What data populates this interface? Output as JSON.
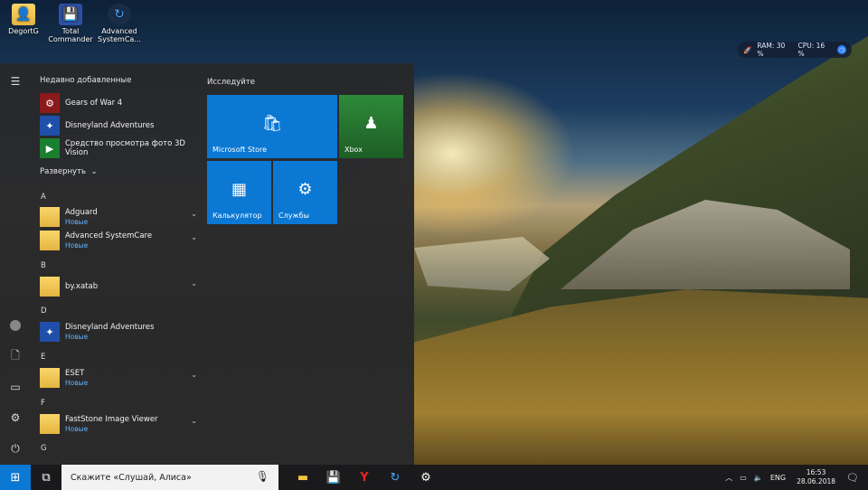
{
  "desktop": {
    "icons": [
      {
        "label": "DegortG",
        "icon": "folder-user-icon"
      },
      {
        "label": "Total Commander",
        "icon": "floppy-disk-icon"
      },
      {
        "label": "Advanced SystemCa...",
        "icon": "systemcare-icon"
      }
    ]
  },
  "monitor": {
    "ram": "RAM: 30 %",
    "cpu": "CPU: 16 %"
  },
  "start_menu": {
    "recent_title": "Недавно добавленные",
    "recent": [
      {
        "name": "Gears of War 4",
        "icon_color": "#8b1a1a"
      },
      {
        "name": "Disneyland Adventures",
        "icon_color": "#1f4fa8"
      },
      {
        "name": "Средство просмотра фото 3D Vision",
        "icon_color": "#1a7f2e"
      }
    ],
    "expand_label": "Развернуть",
    "groups": [
      {
        "letter": "A",
        "apps": [
          {
            "name": "Adguard",
            "sub": "Новые"
          },
          {
            "name": "Advanced SystemCare",
            "sub": "Новые"
          }
        ]
      },
      {
        "letter": "B",
        "apps": [
          {
            "name": "by.xatab",
            "sub": ""
          }
        ]
      },
      {
        "letter": "D",
        "apps": [
          {
            "name": "Disneyland Adventures",
            "sub": "Новые"
          }
        ]
      },
      {
        "letter": "E",
        "apps": [
          {
            "name": "ESET",
            "sub": "Новые"
          }
        ]
      },
      {
        "letter": "F",
        "apps": [
          {
            "name": "FastStone Image Viewer",
            "sub": "Новые"
          }
        ]
      },
      {
        "letter": "G",
        "apps": []
      }
    ],
    "tiles_title": "Исследуйте",
    "tiles": {
      "store": "Microsoft Store",
      "xbox": "Xbox",
      "calc": "Калькулятор",
      "services": "Службы"
    }
  },
  "taskbar": {
    "search_placeholder": "Скажите «Слушай, Алиса»",
    "lang": "ENG",
    "time": "16:53",
    "date": "28.06.2018"
  },
  "colors": {
    "accent": "#0b78d4",
    "new_badge": "#5eb3ff"
  }
}
